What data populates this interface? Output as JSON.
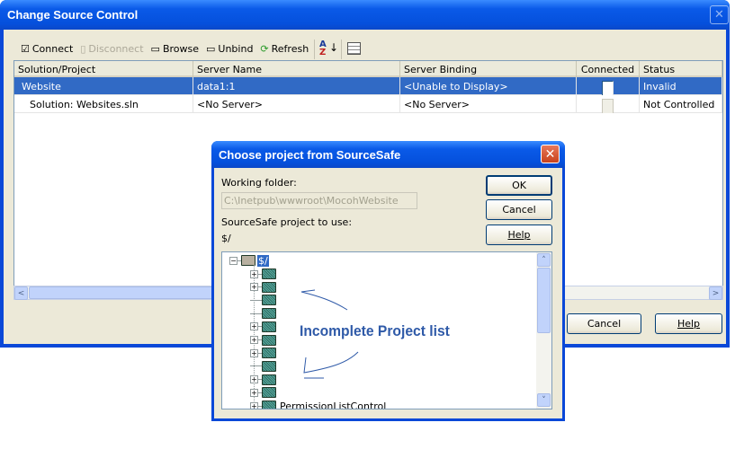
{
  "main_window": {
    "title": "Change Source Control",
    "toolbar": [
      {
        "label": "Connect",
        "icon": "connect-icon",
        "enabled": true
      },
      {
        "label": "Disconnect",
        "icon": "disconnect-icon",
        "enabled": false
      },
      {
        "label": "Browse",
        "icon": "browse-icon",
        "enabled": true
      },
      {
        "label": "Unbind",
        "icon": "unbind-icon",
        "enabled": true
      },
      {
        "label": "Refresh",
        "icon": "refresh-icon",
        "enabled": true
      }
    ],
    "sort_icon": "sort-az-icon",
    "columns_icon": "choose-columns-icon",
    "columns": [
      "Solution/Project",
      "Server Name",
      "Server Binding",
      "Connected",
      "Status"
    ],
    "rows": [
      {
        "project": "Website",
        "server": "data1:1",
        "binding": "<Unable to Display>",
        "connected": false,
        "status": "Invalid",
        "selected": true
      },
      {
        "project": "Solution: Websites.sln",
        "server": "<No Server>",
        "binding": "<No Server>",
        "connected": false,
        "status": "Not Controlled",
        "selected": false
      }
    ],
    "buttons": {
      "cancel": "Cancel",
      "help": "Help"
    }
  },
  "dialog": {
    "title": "Choose project from SourceSafe",
    "working_folder_label": "Working folder:",
    "working_folder_value": "C:\\Inetpub\\wwwroot\\MocohWebsite",
    "project_label": "SourceSafe project to use:",
    "project_value": "$/",
    "buttons": {
      "ok": "OK",
      "cancel": "Cancel",
      "help": "Help"
    },
    "tree_root": "$/",
    "tree_children": [
      {
        "expandable": true
      },
      {
        "expandable": true
      },
      {
        "expandable": false
      },
      {
        "expandable": false
      },
      {
        "expandable": true
      },
      {
        "expandable": true
      },
      {
        "expandable": true
      },
      {
        "expandable": false
      },
      {
        "expandable": true
      },
      {
        "expandable": true
      },
      {
        "expandable": true,
        "label": "PermissionListControl"
      }
    ]
  },
  "annotation": {
    "text": "Incomplete Project list",
    "color": "#2f5aa8"
  }
}
